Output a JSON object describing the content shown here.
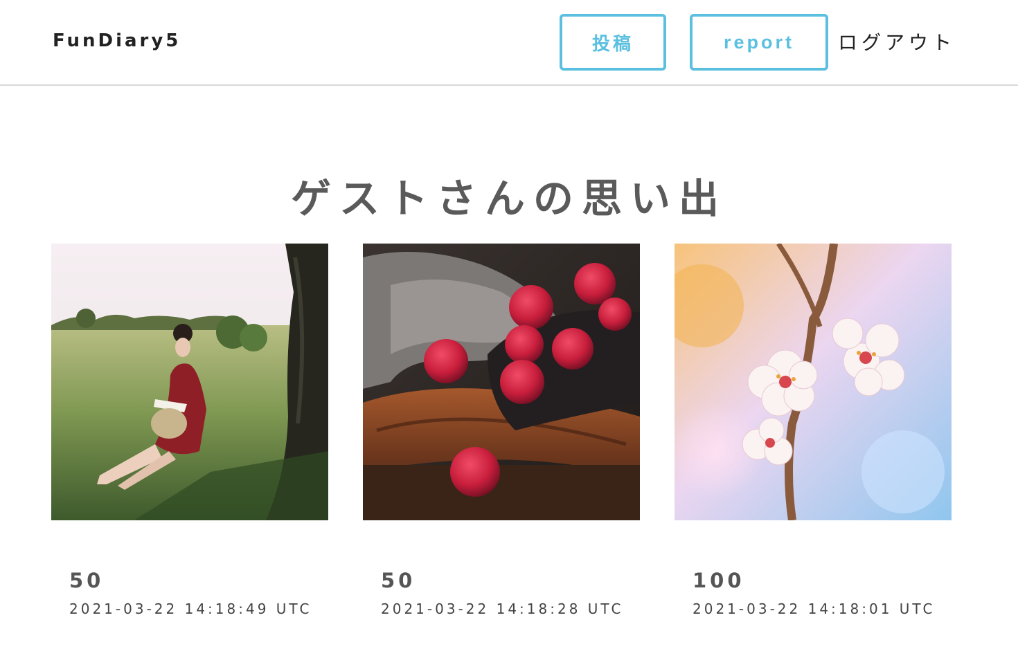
{
  "header": {
    "brand": "FunDiary5",
    "post_label": "投稿",
    "report_label": "report",
    "logout_label": "ログアウト",
    "accent_color": "#5bbfe0"
  },
  "main": {
    "title": "ゲストさんの思い出",
    "posts": [
      {
        "count": "50",
        "created_at": "2021-03-22 14:18:49 UTC",
        "image": "woman-reading-in-field-photo"
      },
      {
        "count": "50",
        "created_at": "2021-03-22 14:18:28 UTC",
        "image": "raspberries-on-wood-photo"
      },
      {
        "count": "100",
        "created_at": "2021-03-22 14:18:01 UTC",
        "image": "cherry-blossom-photo"
      }
    ]
  }
}
